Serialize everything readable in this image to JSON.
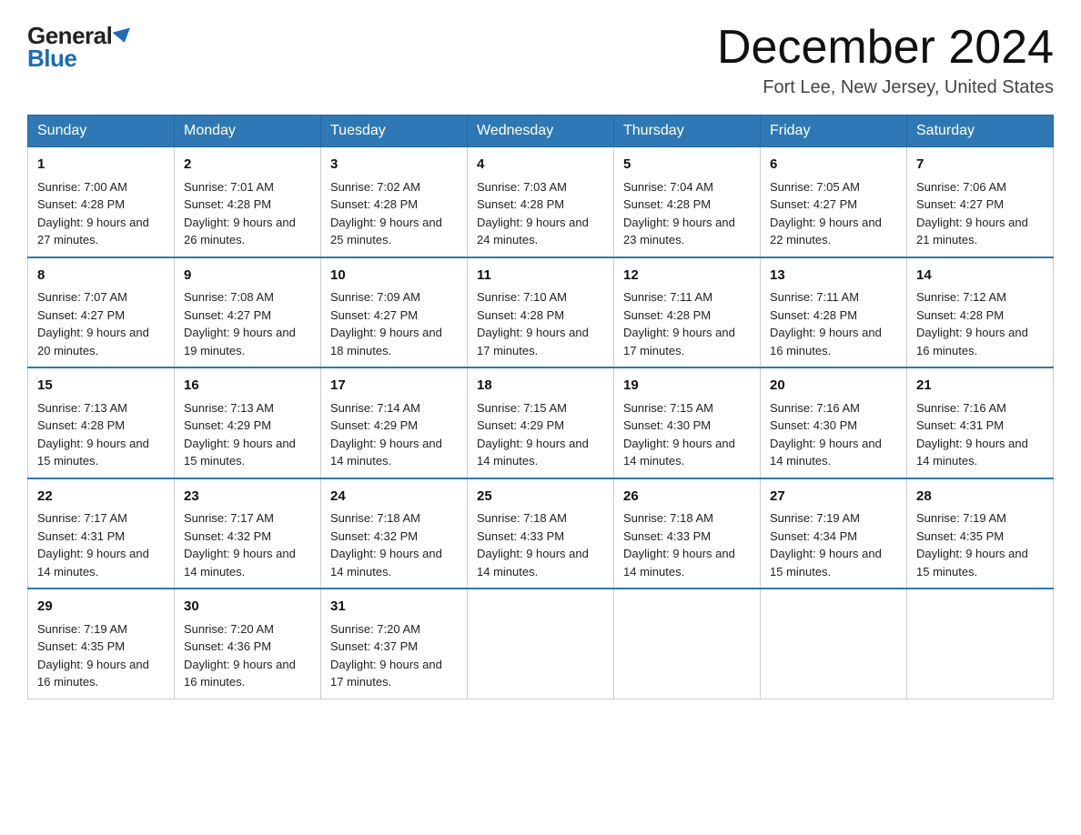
{
  "header": {
    "logo_general": "General",
    "logo_blue": "Blue",
    "month_year": "December 2024",
    "location": "Fort Lee, New Jersey, United States"
  },
  "weekdays": [
    "Sunday",
    "Monday",
    "Tuesday",
    "Wednesday",
    "Thursday",
    "Friday",
    "Saturday"
  ],
  "weeks": [
    [
      {
        "day": "1",
        "sunrise": "7:00 AM",
        "sunset": "4:28 PM",
        "daylight": "9 hours and 27 minutes."
      },
      {
        "day": "2",
        "sunrise": "7:01 AM",
        "sunset": "4:28 PM",
        "daylight": "9 hours and 26 minutes."
      },
      {
        "day": "3",
        "sunrise": "7:02 AM",
        "sunset": "4:28 PM",
        "daylight": "9 hours and 25 minutes."
      },
      {
        "day": "4",
        "sunrise": "7:03 AM",
        "sunset": "4:28 PM",
        "daylight": "9 hours and 24 minutes."
      },
      {
        "day": "5",
        "sunrise": "7:04 AM",
        "sunset": "4:28 PM",
        "daylight": "9 hours and 23 minutes."
      },
      {
        "day": "6",
        "sunrise": "7:05 AM",
        "sunset": "4:27 PM",
        "daylight": "9 hours and 22 minutes."
      },
      {
        "day": "7",
        "sunrise": "7:06 AM",
        "sunset": "4:27 PM",
        "daylight": "9 hours and 21 minutes."
      }
    ],
    [
      {
        "day": "8",
        "sunrise": "7:07 AM",
        "sunset": "4:27 PM",
        "daylight": "9 hours and 20 minutes."
      },
      {
        "day": "9",
        "sunrise": "7:08 AM",
        "sunset": "4:27 PM",
        "daylight": "9 hours and 19 minutes."
      },
      {
        "day": "10",
        "sunrise": "7:09 AM",
        "sunset": "4:27 PM",
        "daylight": "9 hours and 18 minutes."
      },
      {
        "day": "11",
        "sunrise": "7:10 AM",
        "sunset": "4:28 PM",
        "daylight": "9 hours and 17 minutes."
      },
      {
        "day": "12",
        "sunrise": "7:11 AM",
        "sunset": "4:28 PM",
        "daylight": "9 hours and 17 minutes."
      },
      {
        "day": "13",
        "sunrise": "7:11 AM",
        "sunset": "4:28 PM",
        "daylight": "9 hours and 16 minutes."
      },
      {
        "day": "14",
        "sunrise": "7:12 AM",
        "sunset": "4:28 PM",
        "daylight": "9 hours and 16 minutes."
      }
    ],
    [
      {
        "day": "15",
        "sunrise": "7:13 AM",
        "sunset": "4:28 PM",
        "daylight": "9 hours and 15 minutes."
      },
      {
        "day": "16",
        "sunrise": "7:13 AM",
        "sunset": "4:29 PM",
        "daylight": "9 hours and 15 minutes."
      },
      {
        "day": "17",
        "sunrise": "7:14 AM",
        "sunset": "4:29 PM",
        "daylight": "9 hours and 14 minutes."
      },
      {
        "day": "18",
        "sunrise": "7:15 AM",
        "sunset": "4:29 PM",
        "daylight": "9 hours and 14 minutes."
      },
      {
        "day": "19",
        "sunrise": "7:15 AM",
        "sunset": "4:30 PM",
        "daylight": "9 hours and 14 minutes."
      },
      {
        "day": "20",
        "sunrise": "7:16 AM",
        "sunset": "4:30 PM",
        "daylight": "9 hours and 14 minutes."
      },
      {
        "day": "21",
        "sunrise": "7:16 AM",
        "sunset": "4:31 PM",
        "daylight": "9 hours and 14 minutes."
      }
    ],
    [
      {
        "day": "22",
        "sunrise": "7:17 AM",
        "sunset": "4:31 PM",
        "daylight": "9 hours and 14 minutes."
      },
      {
        "day": "23",
        "sunrise": "7:17 AM",
        "sunset": "4:32 PM",
        "daylight": "9 hours and 14 minutes."
      },
      {
        "day": "24",
        "sunrise": "7:18 AM",
        "sunset": "4:32 PM",
        "daylight": "9 hours and 14 minutes."
      },
      {
        "day": "25",
        "sunrise": "7:18 AM",
        "sunset": "4:33 PM",
        "daylight": "9 hours and 14 minutes."
      },
      {
        "day": "26",
        "sunrise": "7:18 AM",
        "sunset": "4:33 PM",
        "daylight": "9 hours and 14 minutes."
      },
      {
        "day": "27",
        "sunrise": "7:19 AM",
        "sunset": "4:34 PM",
        "daylight": "9 hours and 15 minutes."
      },
      {
        "day": "28",
        "sunrise": "7:19 AM",
        "sunset": "4:35 PM",
        "daylight": "9 hours and 15 minutes."
      }
    ],
    [
      {
        "day": "29",
        "sunrise": "7:19 AM",
        "sunset": "4:35 PM",
        "daylight": "9 hours and 16 minutes."
      },
      {
        "day": "30",
        "sunrise": "7:20 AM",
        "sunset": "4:36 PM",
        "daylight": "9 hours and 16 minutes."
      },
      {
        "day": "31",
        "sunrise": "7:20 AM",
        "sunset": "4:37 PM",
        "daylight": "9 hours and 17 minutes."
      },
      null,
      null,
      null,
      null
    ]
  ]
}
